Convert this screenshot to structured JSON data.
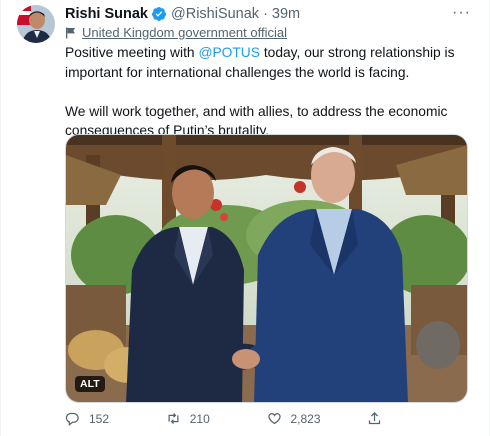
{
  "author": {
    "name": "Rishi Sunak",
    "handle": "@RishiSunak",
    "separator": "·",
    "time": "39m",
    "more_label": "···"
  },
  "label": {
    "text": "United Kingdom government official"
  },
  "tweet": {
    "para1_before": "Positive meeting with ",
    "mention": "@POTUS",
    "para1_after": " today, our strong relationship is important for international challenges the world is facing.",
    "para2": "We will work together, and with allies, to address the economic consequences of Putin’s brutality."
  },
  "media": {
    "alt_badge": "ALT"
  },
  "actions": {
    "replies": "152",
    "retweets": "210",
    "likes": "2,823"
  },
  "colors": {
    "accent": "#1d9bf0",
    "secondary_text": "#536471",
    "retweet_icon": "#00ba7c"
  },
  "icons": [
    "verified-badge-icon",
    "flag-icon",
    "reply-icon",
    "retweet-icon",
    "like-icon",
    "share-icon",
    "more-icon"
  ]
}
